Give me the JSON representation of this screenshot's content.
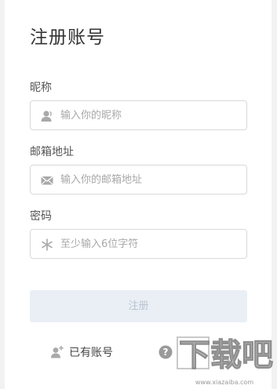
{
  "form": {
    "title": "注册账号",
    "nickname": {
      "label": "昵称",
      "placeholder": "输入你的昵称",
      "icon": "user-icon"
    },
    "email": {
      "label": "邮箱地址",
      "placeholder": "输入你的邮箱地址",
      "icon": "envelope-icon"
    },
    "password": {
      "label": "密码",
      "placeholder": "至少输入6位字符",
      "icon": "asterisk-icon"
    },
    "submit_label": "注册",
    "login_link_label": "已有账号",
    "login_link_icon": "add-user-icon",
    "help_icon": "question-circle-icon"
  },
  "watermark": {
    "text": "下载吧",
    "url_text": "www.xiazaiba.com"
  },
  "colors": {
    "icon": "#a9a9a9",
    "submit_bg": "#eaeff5",
    "submit_text": "#b8c3d0"
  }
}
